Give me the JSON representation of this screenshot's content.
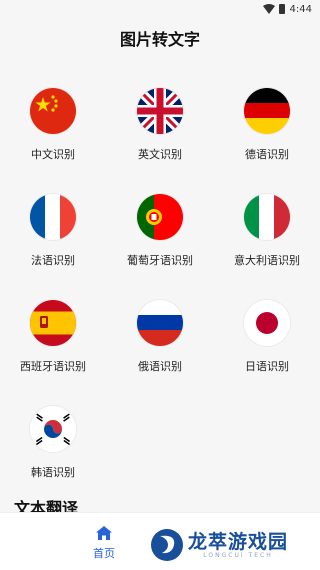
{
  "status": {
    "time": "4:44"
  },
  "header": {
    "title": "图片转文字"
  },
  "languages": [
    {
      "label": "中文识别",
      "flag": "china-flag-icon"
    },
    {
      "label": "英文识别",
      "flag": "uk-flag-icon"
    },
    {
      "label": "德语识别",
      "flag": "germany-flag-icon"
    },
    {
      "label": "法语识别",
      "flag": "france-flag-icon"
    },
    {
      "label": "葡萄牙语识别",
      "flag": "portugal-flag-icon"
    },
    {
      "label": "意大利语识别",
      "flag": "italy-flag-icon"
    },
    {
      "label": "西班牙语识别",
      "flag": "spain-flag-icon"
    },
    {
      "label": "俄语识别",
      "flag": "russia-flag-icon"
    },
    {
      "label": "日语识别",
      "flag": "japan-flag-icon"
    },
    {
      "label": "韩语识别",
      "flag": "korea-flag-icon"
    }
  ],
  "section": {
    "title": "文本翻译"
  },
  "bottom_nav": {
    "home_label": "首页",
    "accent": "#2a62d8"
  },
  "watermark": {
    "cn": "龙萃游戏园",
    "en": "LONGCUI TECH"
  }
}
